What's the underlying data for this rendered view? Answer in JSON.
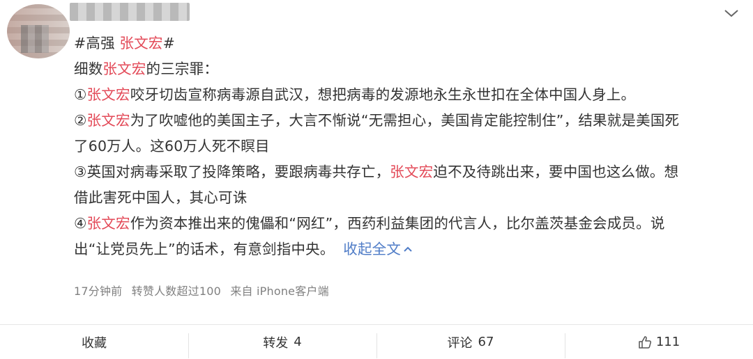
{
  "post": {
    "hashtag_prefix": "#高强 ",
    "hashtag_name": "张文宏",
    "hashtag_suffix": "#",
    "lines": [
      [
        {
          "t": "细数"
        },
        {
          "t": "张文宏",
          "red": true
        },
        {
          "t": "的三宗罪："
        }
      ],
      [
        {
          "t": "①"
        },
        {
          "t": "张文宏",
          "red": true
        },
        {
          "t": "咬牙切齿宣称病毒源自武汉，想把病毒的发源地永生永世扣在全体中国人身上。"
        }
      ],
      [
        {
          "t": "②"
        },
        {
          "t": "张文宏",
          "red": true
        },
        {
          "t": "为了吹嘘他的美国主子，大言不惭说“无需担心，美国肯定能控制住”，结果就是美国死"
        }
      ],
      [
        {
          "t": "了60万人。这60万人死不瞑目"
        }
      ],
      [
        {
          "t": "③英国对病毒采取了投降策略，要跟病毒共存亡，"
        },
        {
          "t": "张文宏",
          "red": true
        },
        {
          "t": "迫不及待跳出来，要中国也这么做。想"
        }
      ],
      [
        {
          "t": "借此害死中国人，其心可诛"
        }
      ],
      [
        {
          "t": "④"
        },
        {
          "t": "张文宏",
          "red": true
        },
        {
          "t": "作为资本推出来的傀儡和“网红”，西药利益集团的代言人，比尔盖茨基金会成员。说"
        }
      ]
    ],
    "last_line_text": "出“让党员先上”的话术，有意剑指中央。",
    "collapse_label": "收起全文",
    "meta": {
      "time": "17分钟前",
      "reposts_note": "转赞人数超过100",
      "source": "来自 iPhone客户端"
    }
  },
  "actions": {
    "favorite": "收藏",
    "repost_label": "转发",
    "repost_count": "4",
    "comment_label": "评论",
    "comment_count": "67",
    "like_count": "111"
  },
  "colors": {
    "highlight": "#e34a58",
    "link": "#4f7cc7"
  },
  "icons": [
    "chevron-down-icon",
    "thumbs-up-icon",
    "chevron-up-icon"
  ]
}
